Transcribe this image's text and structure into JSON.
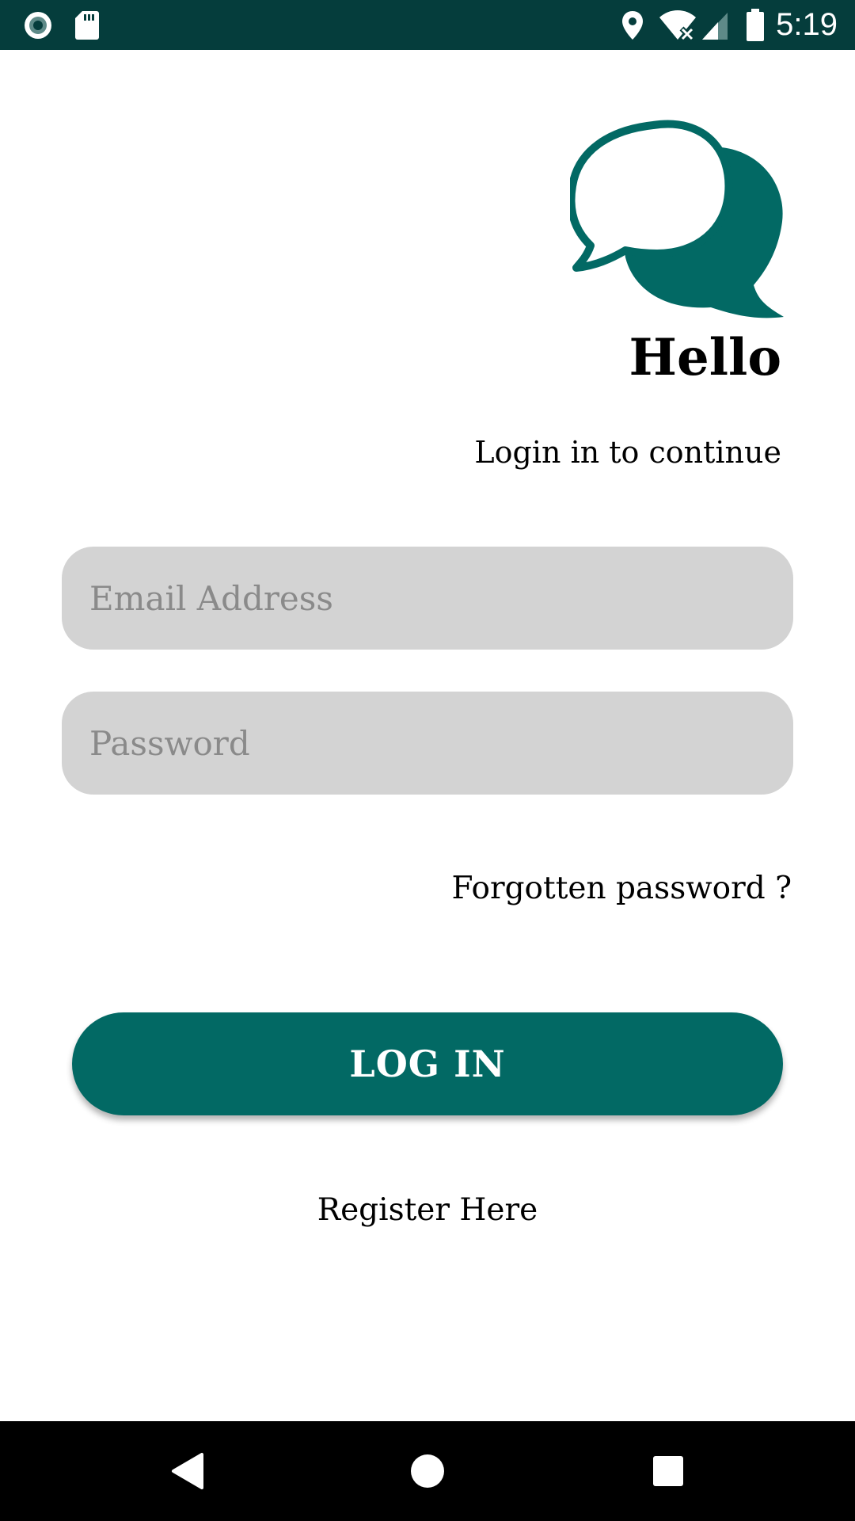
{
  "status_bar": {
    "time": "5:19",
    "left_icons": [
      "record-icon",
      "sd-card-icon"
    ],
    "right_icons": [
      "location-icon",
      "wifi-icon",
      "cell-signal-icon",
      "battery-icon"
    ]
  },
  "greeting": {
    "title": "Hello",
    "subtitle": "Login in to continue"
  },
  "form": {
    "email_placeholder": "Email Address",
    "email_value": "",
    "password_placeholder": "Password",
    "password_value": ""
  },
  "links": {
    "forgot_password": "Forgotten password ?",
    "register": "Register Here"
  },
  "actions": {
    "login_label": "LOG IN"
  },
  "nav_bar": {
    "buttons": [
      "back-icon",
      "home-icon",
      "recents-icon"
    ]
  },
  "colors": {
    "status_bar": "#053d3c",
    "brand": "#026964",
    "field_background": "#d3d3d3",
    "nav_bar": "#000000"
  }
}
